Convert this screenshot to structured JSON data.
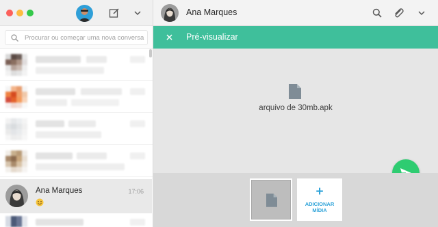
{
  "sidebar": {
    "search": {
      "placeholder": "Procurar ou começar uma nova conversa"
    },
    "active_chat": {
      "name": "Ana Marques",
      "time": "17:06"
    }
  },
  "chat": {
    "contact_name": "Ana Marques",
    "preview": {
      "title": "Pré-visualizar",
      "file_name": "arquivo de 30mb.apk",
      "add_media_label": "ADICIONAR MÍDIA"
    }
  },
  "colors": {
    "accent": "#3fbf9b",
    "send_button": "#2ecc71",
    "add_media": "#2ea3d9"
  },
  "icons": [
    "compose-icon",
    "chevron-down-icon",
    "search-icon",
    "attach-icon",
    "close-icon",
    "file-icon",
    "send-icon",
    "plus-icon",
    "smiley-emoji-icon"
  ]
}
